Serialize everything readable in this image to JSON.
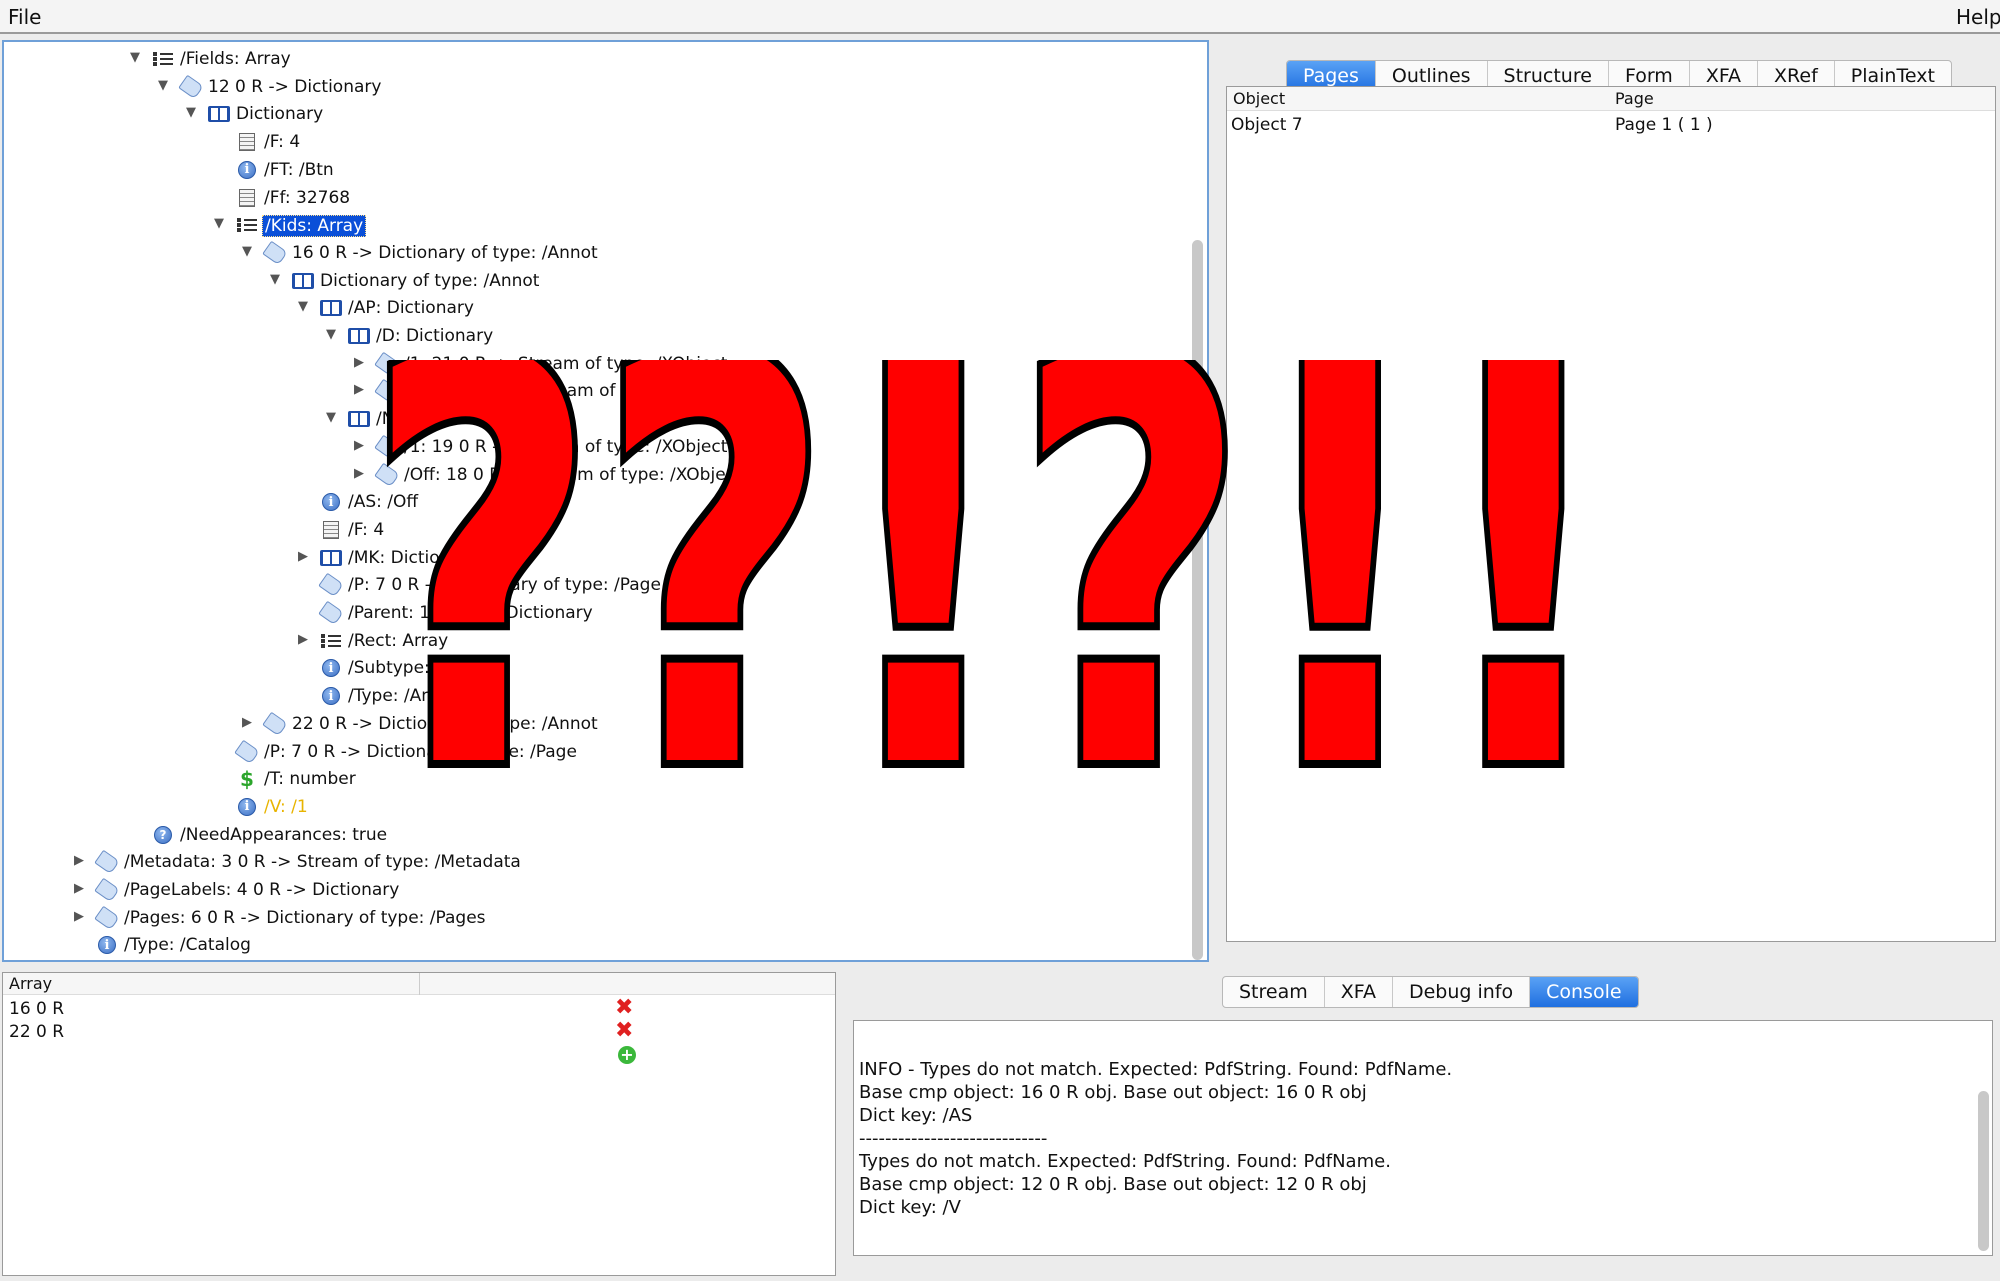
{
  "menu": {
    "file": "File",
    "help": "Help"
  },
  "tree": {
    "rows": [
      {
        "label": "/Fields: Array",
        "icon": "array-icon",
        "toggle": "▼"
      },
      {
        "label": "12 0 R -> Dictionary",
        "icon": "tag-icon",
        "toggle": "▼"
      },
      {
        "label": "Dictionary",
        "icon": "book-icon",
        "toggle": "▼"
      },
      {
        "label": "/F: 4",
        "icon": "number-icon",
        "toggle": ""
      },
      {
        "label": "/FT: /Btn",
        "icon": "info-icon",
        "toggle": ""
      },
      {
        "label": "/Ff: 32768",
        "icon": "number-icon",
        "toggle": ""
      },
      {
        "label": "/Kids: Array",
        "icon": "array-icon",
        "toggle": "▼"
      },
      {
        "label": "16 0 R -> Dictionary of type: /Annot",
        "icon": "tag-icon",
        "toggle": "▼"
      },
      {
        "label": "Dictionary of type: /Annot",
        "icon": "book-icon",
        "toggle": "▼"
      },
      {
        "label": "/AP: Dictionary",
        "icon": "book-icon",
        "toggle": "▼"
      },
      {
        "label": "/D: Dictionary",
        "icon": "book-icon",
        "toggle": "▼"
      },
      {
        "label": "/1: 21 0 R -> Stream of type: /XObject",
        "icon": "tag-icon",
        "toggle": "▶"
      },
      {
        "label": "/Off: 20 0 R -> Stream of type: /XObject",
        "icon": "tag-icon",
        "toggle": "▶"
      },
      {
        "label": "/N: Dictionary",
        "icon": "book-icon",
        "toggle": "▼"
      },
      {
        "label": "/1: 19 0 R -> Stream of type: /XObject",
        "icon": "tag-icon",
        "toggle": "▶"
      },
      {
        "label": "/Off: 18 0 R -> Stream of type: /XObject",
        "icon": "tag-icon",
        "toggle": "▶"
      },
      {
        "label": "/AS: /Off",
        "icon": "info-icon",
        "toggle": ""
      },
      {
        "label": "/F: 4",
        "icon": "number-icon",
        "toggle": ""
      },
      {
        "label": "/MK: Dictionary",
        "icon": "book-icon",
        "toggle": "▶"
      },
      {
        "label": "/P: 7 0 R -> Dictionary of type: /Page",
        "icon": "tag-icon",
        "toggle": ""
      },
      {
        "label": "/Parent: 12 0 R -> Dictionary",
        "icon": "tag-icon",
        "toggle": ""
      },
      {
        "label": "/Rect: Array",
        "icon": "array-icon",
        "toggle": "▶"
      },
      {
        "label": "/Subtype: /Widget",
        "icon": "info-icon",
        "toggle": ""
      },
      {
        "label": "/Type: /Annot",
        "icon": "info-icon",
        "toggle": ""
      },
      {
        "label": "22 0 R -> Dictionary of type: /Annot",
        "icon": "tag-icon",
        "toggle": "▶"
      },
      {
        "label": "/P: 7 0 R -> Dictionary of type: /Page",
        "icon": "tag-icon",
        "toggle": ""
      },
      {
        "label": "/T: number",
        "icon": "dollar-icon",
        "toggle": ""
      },
      {
        "label": "/V: /1",
        "icon": "info-icon",
        "toggle": ""
      },
      {
        "label": "/NeedAppearances: true",
        "icon": "help-icon",
        "toggle": ""
      },
      {
        "label": "/Metadata: 3 0 R -> Stream of type: /Metadata",
        "icon": "tag-icon",
        "toggle": "▶"
      },
      {
        "label": "/PageLabels: 4 0 R -> Dictionary",
        "icon": "tag-icon",
        "toggle": "▶"
      },
      {
        "label": "/Pages: 6 0 R -> Dictionary of type: /Pages",
        "icon": "tag-icon",
        "toggle": "▶"
      },
      {
        "label": "/Type: /Catalog",
        "icon": "info-icon",
        "toggle": ""
      }
    ]
  },
  "right_tabs": [
    "Pages",
    "Outlines",
    "Structure",
    "Form",
    "XFA",
    "XRef",
    "PlainText"
  ],
  "pages_table": {
    "headers": [
      "Object",
      "Page"
    ],
    "rows": [
      {
        "object": "Object 7",
        "page": "Page 1 ( 1 )"
      }
    ]
  },
  "array_panel": {
    "header": "Array",
    "items": [
      "16 0 R",
      "22 0 R"
    ]
  },
  "console_tabs": [
    "Stream",
    "XFA",
    "Debug info",
    "Console"
  ],
  "console_lines": [
    "INFO  - Types do not match. Expected: PdfString. Found: PdfName.",
    "Base cmp object: 16 0 R obj. Base out object: 16 0 R obj",
    "Dict key: /AS",
    "-----------------------------",
    "Types do not match. Expected: PdfString. Found: PdfName.",
    "Base cmp object: 12 0 R obj. Base out object: 12 0 R obj",
    "Dict key: /V"
  ],
  "overlay_text": "??!?!!",
  "colors": {
    "accent": "#1f6fe0",
    "selection": "#0a4fd8",
    "overlay": "#ff0000",
    "highlight_value": "#e8b400"
  }
}
